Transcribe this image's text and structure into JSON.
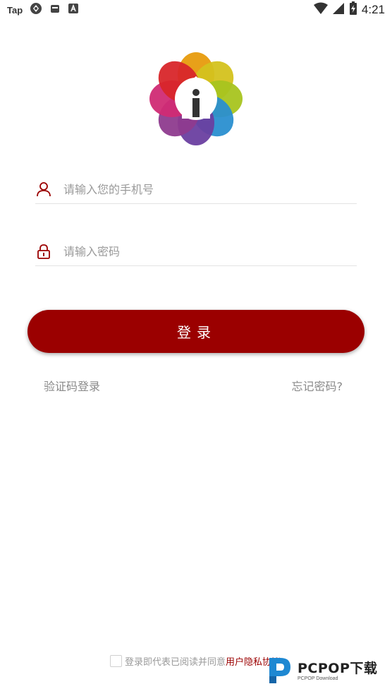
{
  "status_bar": {
    "tap_label": "Tap",
    "time": "4:21",
    "icons": [
      "sync-icon",
      "bag-icon",
      "a-icon",
      "wifi-icon",
      "signal-icon",
      "battery-icon"
    ]
  },
  "logo": {
    "icon": "app-logo-icon"
  },
  "form": {
    "phone_placeholder": "请输入您的手机号",
    "password_placeholder": "请输入密码",
    "login_label": "登录",
    "sms_login_label": "验证码登录",
    "forgot_label": "忘记密码?"
  },
  "agreement": {
    "prefix": "登录即代表已阅读并同意",
    "link": "用户隐私协议"
  },
  "watermark": {
    "main": "PCPOP下载",
    "sub": "PCPOP Download"
  },
  "colors": {
    "accent": "#9b0000",
    "placeholder": "#9a9a9a",
    "divider": "#e3e3e3"
  }
}
